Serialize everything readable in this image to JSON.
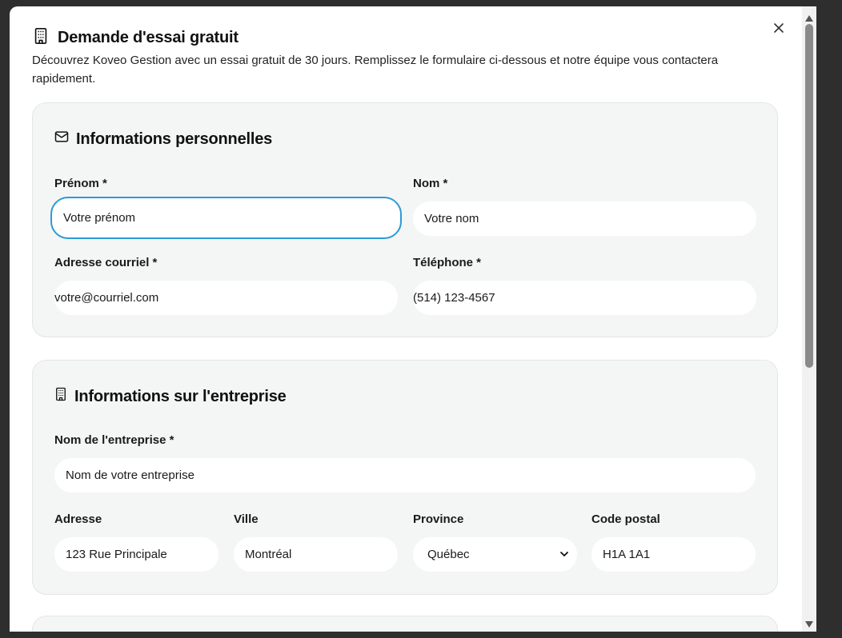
{
  "dialog": {
    "title": "Demande d'essai gratuit",
    "description": "Découvrez Koveo Gestion avec un essai gratuit de 30 jours. Remplissez le formulaire ci-dessous et notre équipe vous contactera rapidement.",
    "close_icon": "close-icon"
  },
  "personal": {
    "title": "Informations personnelles",
    "icon": "mail-icon",
    "first_name": {
      "label": "Prénom *",
      "placeholder": "Votre prénom"
    },
    "last_name": {
      "label": "Nom *",
      "placeholder": "Votre nom"
    },
    "email": {
      "label": "Adresse courriel *",
      "placeholder": "votre@courriel.com"
    },
    "phone": {
      "label": "Téléphone *",
      "placeholder": "(514) 123-4567"
    }
  },
  "company": {
    "title": "Informations sur l'entreprise",
    "icon": "building-icon",
    "name": {
      "label": "Nom de l'entreprise *",
      "placeholder": "Nom de votre entreprise"
    },
    "address": {
      "label": "Adresse",
      "placeholder": "123 Rue Principale"
    },
    "city": {
      "label": "Ville",
      "placeholder": "Montréal"
    },
    "province": {
      "label": "Province",
      "value": "Québec"
    },
    "postal": {
      "label": "Code postal",
      "placeholder": "H1A 1A1"
    }
  },
  "colors": {
    "focus_ring": "#2b9ad8",
    "card_bg": "#f4f6f5"
  }
}
